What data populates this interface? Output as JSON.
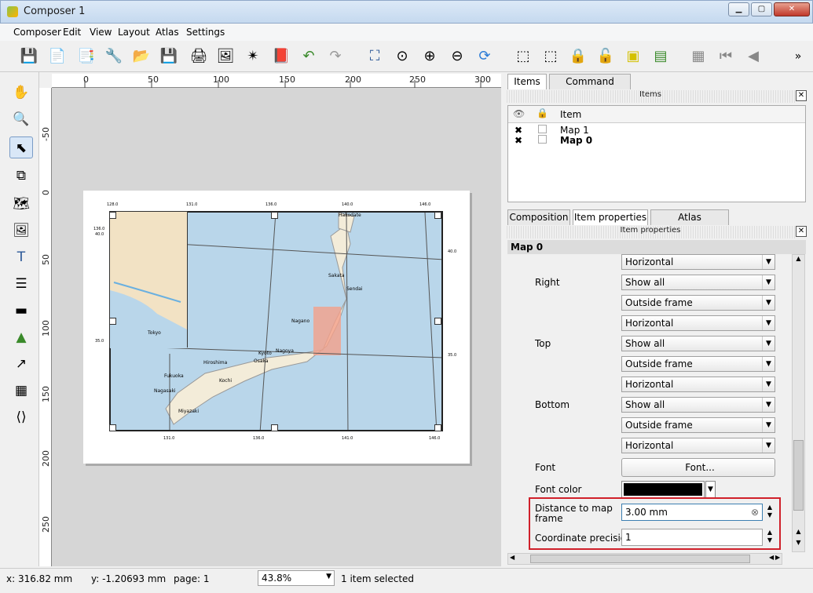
{
  "window": {
    "title": "Composer 1"
  },
  "menus": [
    "Composer",
    "Edit",
    "View",
    "Layout",
    "Atlas",
    "Settings"
  ],
  "toolbar": {
    "overflow_label": "»"
  },
  "rulers": {
    "h_ticks": [
      "0",
      "50",
      "100",
      "150",
      "200",
      "250",
      "300"
    ],
    "v_ticks": [
      "-50",
      "0",
      "50",
      "100",
      "150",
      "200",
      "250"
    ]
  },
  "map": {
    "top_labels": [
      "128.0",
      "131.0",
      "136.0",
      "140.0",
      "146.0"
    ],
    "bottom_labels": [
      "131.0",
      "136.0",
      "141.0",
      "146.0"
    ],
    "left_labels": [
      "136.0",
      "40.0",
      "35.0"
    ],
    "right_labels": [
      "40.0",
      "35.0"
    ],
    "cities": [
      "Hakodate",
      "Sakata",
      "Sendai",
      "Nagano",
      "Nagoya",
      "Kyoto",
      "Osaka",
      "Hiroshima",
      "Kochi",
      "Fukuoka",
      "Nagasaki",
      "Miyazaki",
      "Tokyo"
    ]
  },
  "panel": {
    "tabs_top": [
      "Items",
      "Command history"
    ],
    "items_header": "Items",
    "items_col": "Item",
    "items": [
      {
        "name": "Map 1",
        "bold": false
      },
      {
        "name": "Map 0",
        "bold": true
      }
    ],
    "tabs_mid": [
      "Composition",
      "Item properties",
      "Atlas generation"
    ],
    "props_header": "Item properties",
    "section_title": "Map 0",
    "rows": [
      {
        "label": "",
        "value": "Horizontal"
      },
      {
        "label": "Right",
        "value": "Show all"
      },
      {
        "label": "",
        "value": "Outside frame"
      },
      {
        "label": "",
        "value": "Horizontal"
      },
      {
        "label": "Top",
        "value": "Show all"
      },
      {
        "label": "",
        "value": "Outside frame"
      },
      {
        "label": "",
        "value": "Horizontal"
      },
      {
        "label": "Bottom",
        "value": "Show all"
      },
      {
        "label": "",
        "value": "Outside frame"
      },
      {
        "label": "",
        "value": "Horizontal"
      }
    ],
    "font_label": "Font",
    "font_button": "Font...",
    "font_color_label": "Font color",
    "distance_label_1": "Distance to map",
    "distance_label_2": "frame",
    "distance_value": "3.00 mm",
    "precision_label": "Coordinate precision",
    "precision_value": "1",
    "highlight_color": "#d0202a"
  },
  "status": {
    "x": "x: 316.82 mm",
    "y": "y: -1.20693 mm",
    "page": "page: 1",
    "zoom": "43.8%",
    "selected": "1 item selected"
  }
}
